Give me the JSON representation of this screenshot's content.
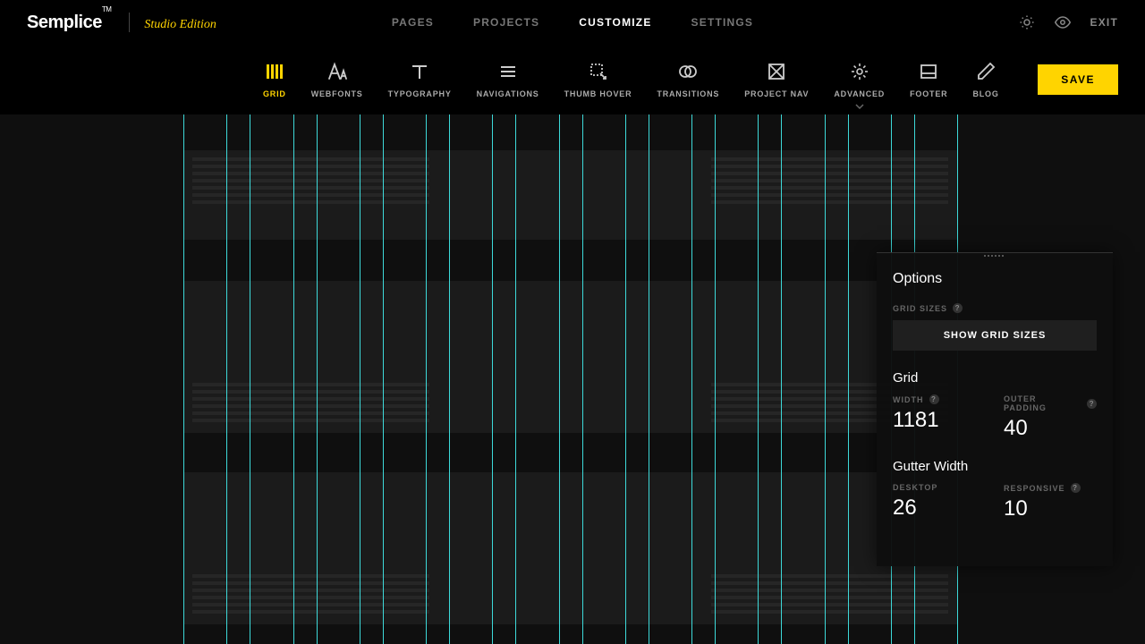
{
  "header": {
    "logo": "Semplice",
    "tm": "TM",
    "edition": "Studio Edition",
    "nav": [
      "PAGES",
      "PROJECTS",
      "CUSTOMIZE",
      "SETTINGS"
    ],
    "active_nav": 2,
    "exit": "EXIT"
  },
  "toolbar": {
    "tools": [
      {
        "label": "GRID"
      },
      {
        "label": "WEBFONTS"
      },
      {
        "label": "TYPOGRAPHY"
      },
      {
        "label": "NAVIGATIONS"
      },
      {
        "label": "THUMB HOVER"
      },
      {
        "label": "TRANSITIONS"
      },
      {
        "label": "PROJECT NAV"
      },
      {
        "label": "ADVANCED"
      },
      {
        "label": "FOOTER"
      },
      {
        "label": "BLOG"
      }
    ],
    "active_tool": 0,
    "save": "SAVE"
  },
  "panel": {
    "title": "Options",
    "grid_sizes_label": "GRID SIZES",
    "show_button": "SHOW GRID SIZES",
    "grid_heading": "Grid",
    "width_label": "WIDTH",
    "width_value": "1181",
    "outer_label": "OUTER PADDING",
    "outer_value": "40",
    "gutter_heading": "Gutter Width",
    "desktop_label": "DESKTOP",
    "desktop_value": "26",
    "responsive_label": "RESPONSIVE",
    "responsive_value": "10"
  }
}
